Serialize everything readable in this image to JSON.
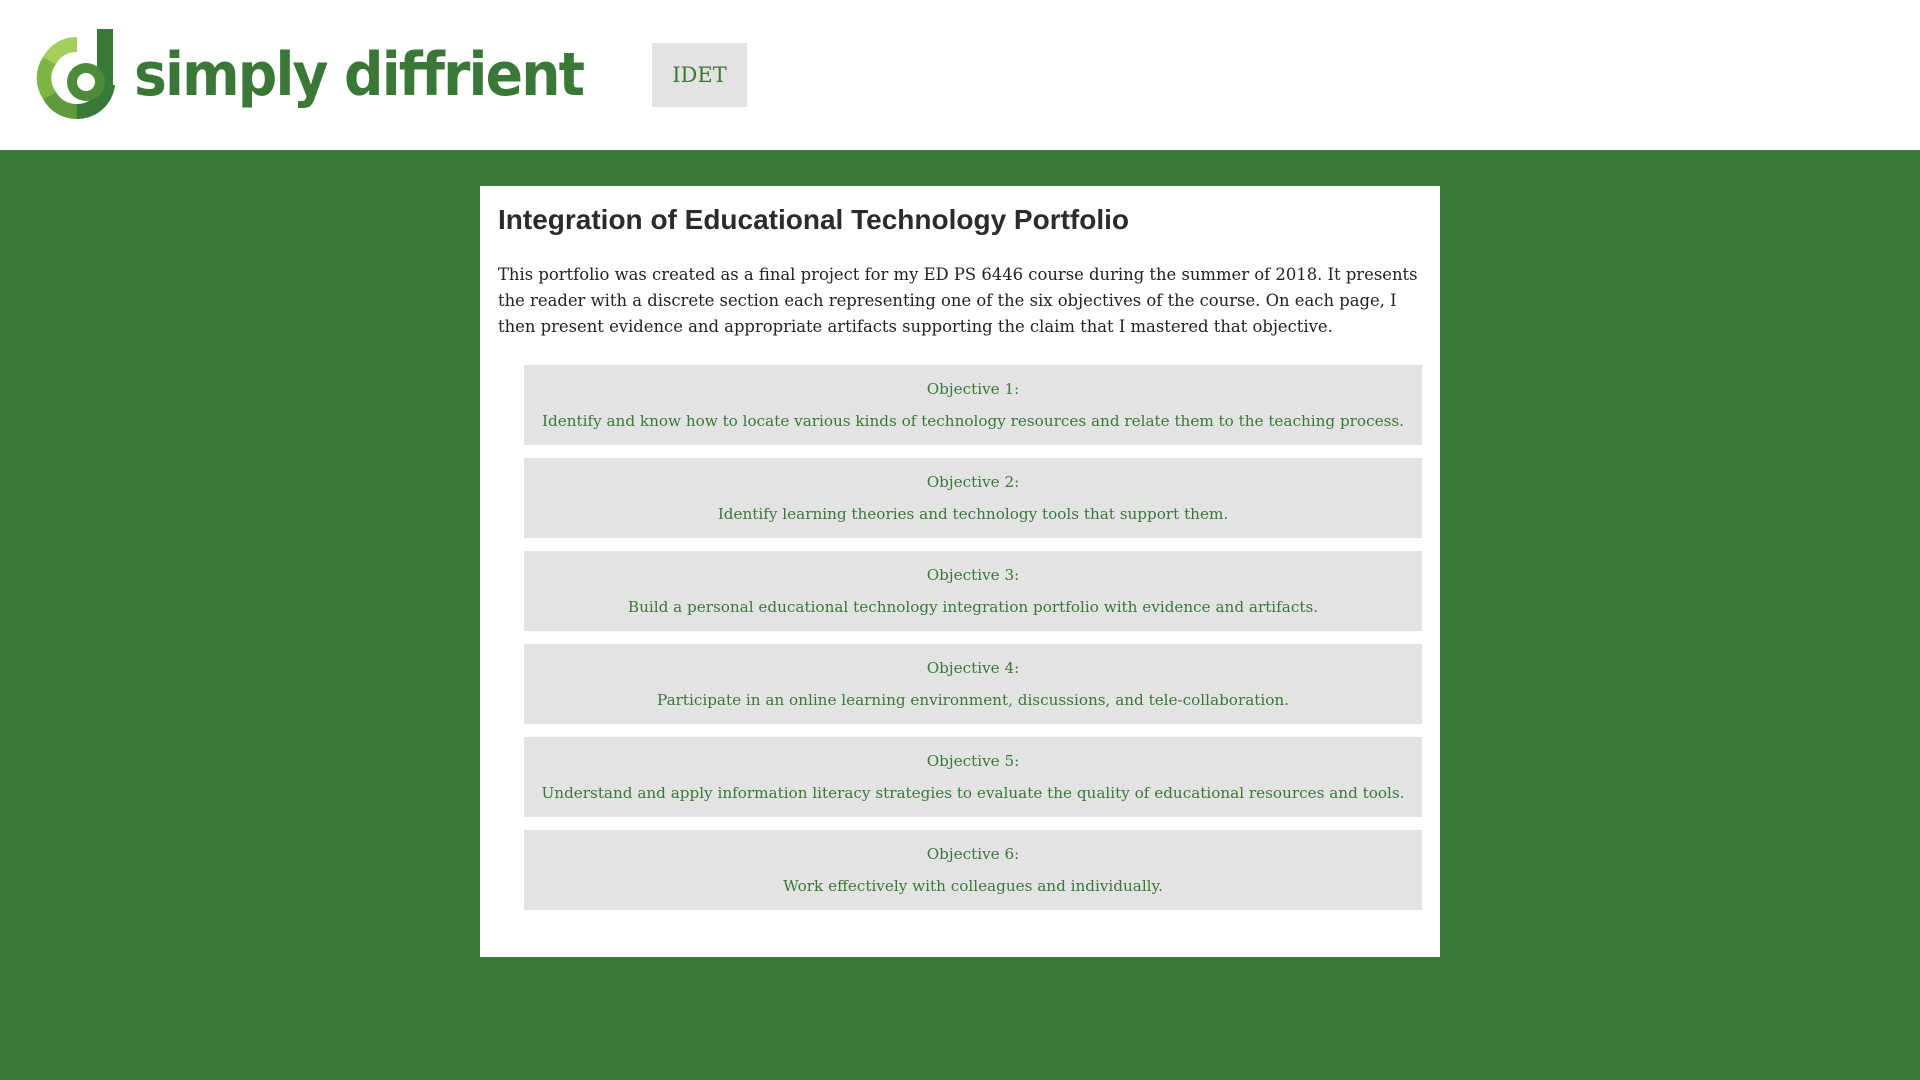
{
  "header": {
    "logo_text": "simply diffrient",
    "nav_button_label": "IDET"
  },
  "colors": {
    "brand_green": "#3a7837",
    "light_green": "#7fb543",
    "panel_gray": "#e3e3e3"
  },
  "main": {
    "title": "Integration of Educational Technology Portfolio",
    "intro": "This portfolio was created as a final project for my ED PS 6446 course during the summer of 2018. It presents the reader with a discrete section each representing one of the six objectives of the course. On each page, I then present evidence and appropriate artifacts supporting the claim that I mastered that objective.",
    "objectives": [
      {
        "label": "Objective 1:",
        "description": "Identify and know how to locate various kinds of technology resources and relate them to the teaching process."
      },
      {
        "label": "Objective 2:",
        "description": "Identify learning theories and technology tools that support them."
      },
      {
        "label": "Objective 3:",
        "description": "Build a personal educational technology integration portfolio with evidence and artifacts."
      },
      {
        "label": "Objective 4:",
        "description": "Participate in an online learning environment, discussions, and tele-collaboration."
      },
      {
        "label": "Objective 5:",
        "description": "Understand and apply information literacy strategies to evaluate the quality of educational resources and tools."
      },
      {
        "label": "Objective 6:",
        "description": "Work effectively with colleagues and individually."
      }
    ]
  }
}
